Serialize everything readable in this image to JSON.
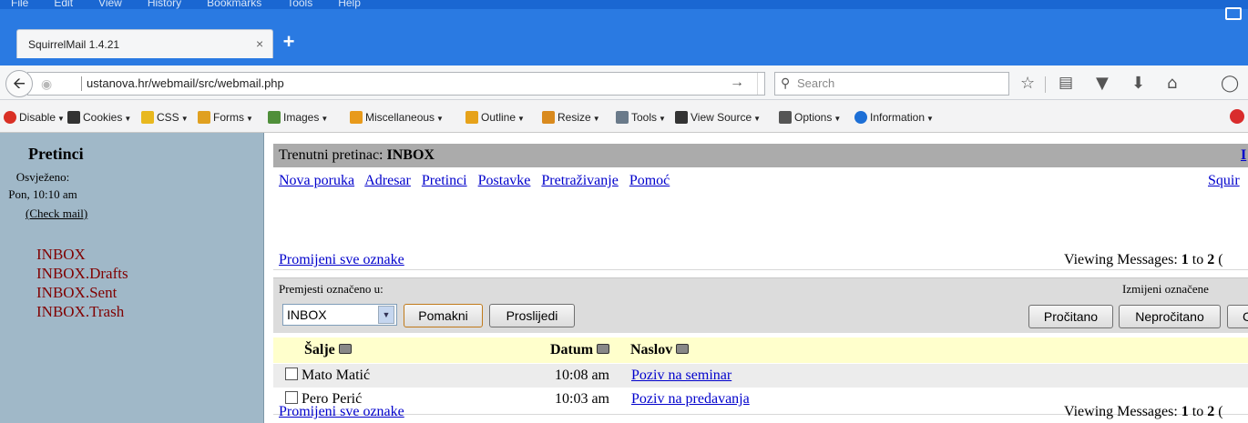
{
  "browser": {
    "menu": [
      "File",
      "Edit",
      "View",
      "History",
      "Bookmarks",
      "Tools",
      "Help"
    ],
    "tab_title": "SquirrelMail 1.4.21",
    "tab_close": "×",
    "new_tab": "+",
    "url": "ustanova.hr/webmail/src/webmail.php",
    "search_placeholder": "Search",
    "nav_icons": [
      "back-icon",
      "go-arrow-icon",
      "star-icon",
      "reading-list-icon",
      "pocket-icon",
      "download-icon",
      "home-icon",
      "chat-icon"
    ]
  },
  "toolbar": {
    "items": [
      {
        "label": "Disable",
        "icon": "disable-icon",
        "color": "#d93025"
      },
      {
        "label": "Cookies",
        "icon": "cookies-icon",
        "color": "#333333"
      },
      {
        "label": "CSS",
        "icon": "css-icon",
        "color": "#e8b81f"
      },
      {
        "label": "Forms",
        "icon": "forms-icon",
        "color": "#e0a020"
      },
      {
        "label": "Images",
        "icon": "images-icon",
        "color": "#4f8f3a"
      },
      {
        "label": "Miscellaneous",
        "icon": "misc-icon",
        "color": "#e89a1b"
      },
      {
        "label": "Outline",
        "icon": "outline-icon",
        "color": "#e6a21a"
      },
      {
        "label": "Resize",
        "icon": "resize-icon",
        "color": "#d98a1e"
      },
      {
        "label": "Tools",
        "icon": "tools-icon",
        "color": "#6a7a8a"
      },
      {
        "label": "View Source",
        "icon": "view-source-icon",
        "color": "#333333"
      },
      {
        "label": "Options",
        "icon": "options-icon",
        "color": "#555555"
      },
      {
        "label": "Information",
        "icon": "information-icon",
        "color": "#1d6fd6"
      }
    ]
  },
  "sidebar": {
    "title": "Pretinci",
    "refreshed_label": "Osvježeno:",
    "refreshed_time": "Pon, 10:10 am",
    "check_mail": "(Check mail)",
    "folders": [
      "INBOX",
      "INBOX.Drafts",
      "INBOX.Sent",
      "INBOX.Trash"
    ]
  },
  "main": {
    "current_folder_label": "Trenutni pretinac:",
    "current_folder": "INBOX",
    "header_right": "I",
    "nav_links": [
      "Nova poruka",
      "Adresar",
      "Pretinci",
      "Postavke",
      "Pretraživanje",
      "Pomoć"
    ],
    "nav_right": "Squir",
    "toggle_all": "Promijeni sve oznake",
    "viewing_prefix": "Viewing Messages:",
    "viewing_from": "1",
    "viewing_to_word": "to",
    "viewing_to": "2",
    "viewing_suffix": "(",
    "move_label": "Premjesti označeno u:",
    "move_target": "INBOX",
    "move_button": "Pomakni",
    "forward_button": "Proslijedi",
    "mark_label": "Izmijeni označene",
    "read_button": "Pročitano",
    "unread_button": "Nepročitano",
    "partial_button": "C",
    "columns": {
      "from": "Šalje",
      "date": "Datum",
      "subject": "Naslov"
    },
    "messages": [
      {
        "from": "Mato Matić",
        "date": "10:08 am",
        "subject": "Poziv na seminar"
      },
      {
        "from": "Pero Perić",
        "date": "10:03 am",
        "subject": "Poziv na predavanja"
      }
    ],
    "colors": {
      "header_gray": "#ababab",
      "table_header": "#ffffcc",
      "row_alt": "#ececec",
      "sidebar": "#a0b8c8",
      "folder_link": "#800000",
      "link": "#0000cc"
    }
  }
}
